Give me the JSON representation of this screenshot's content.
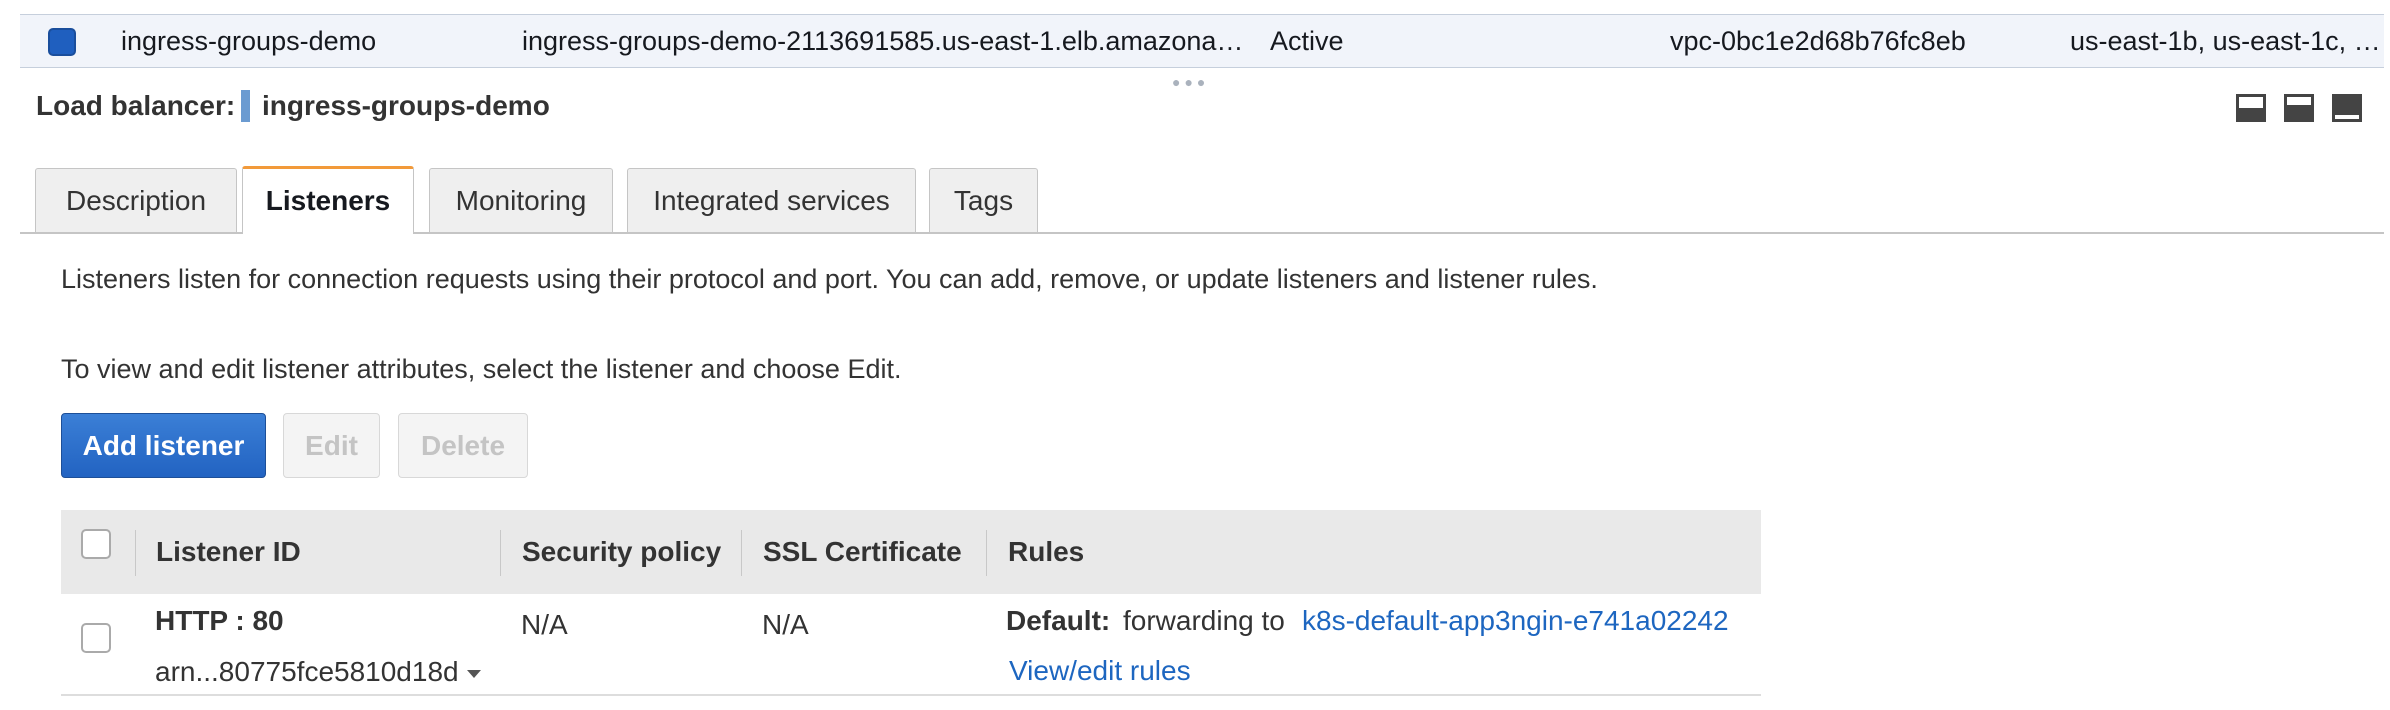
{
  "top_row": {
    "name": "ingress-groups-demo",
    "dns_name": "ingress-groups-demo-2113691585.us-east-1.elb.amazona…",
    "state": "Active",
    "vpc_id": "vpc-0bc1e2d68b76fc8eb",
    "availability_zones": "us-east-1b, us-east-1c, …"
  },
  "panel": {
    "label": "Load balancer:",
    "name": "ingress-groups-demo"
  },
  "tabs": [
    {
      "label": "Description",
      "active": false
    },
    {
      "label": "Listeners",
      "active": true
    },
    {
      "label": "Monitoring",
      "active": false
    },
    {
      "label": "Integrated services",
      "active": false
    },
    {
      "label": "Tags",
      "active": false
    }
  ],
  "listeners": {
    "intro": "Listeners listen for connection requests using their protocol and port. You can add, remove, or update listeners and listener rules.",
    "hint": "To view and edit listener attributes, select the listener and choose Edit.",
    "buttons": {
      "add": "Add listener",
      "edit": "Edit",
      "delete": "Delete"
    },
    "columns": [
      "Listener ID",
      "Security policy",
      "SSL Certificate",
      "Rules"
    ],
    "rows": [
      {
        "listener_id": "HTTP : 80",
        "arn": "arn...80775fce5810d18d",
        "security_policy": "N/A",
        "ssl_certificate": "N/A",
        "rule_default_label": "Default:",
        "rule_action": "forwarding to",
        "rule_target": "k8s-default-app3ngin-e741a02242",
        "view_rules": "View/edit rules"
      }
    ]
  },
  "colors": {
    "primary_button": "#2263c2",
    "active_tab_accent": "#f29a3a",
    "link": "#1d66c0",
    "selected_row": "#f1f4fa"
  }
}
